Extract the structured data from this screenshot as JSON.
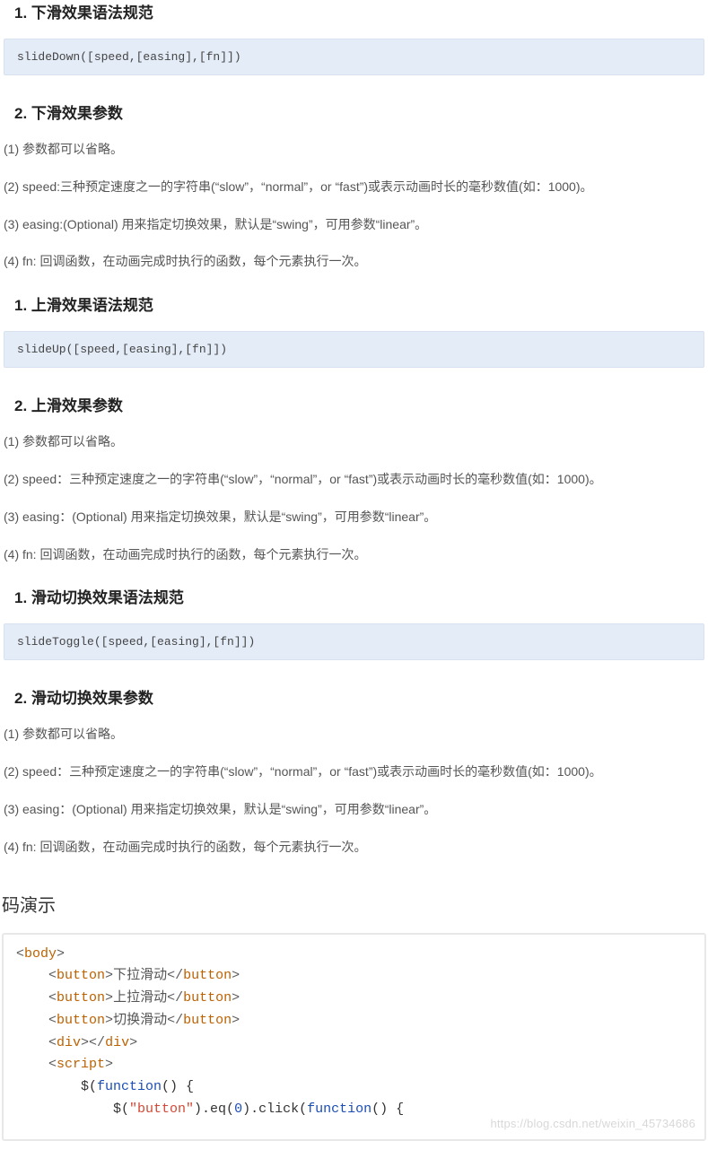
{
  "sections": [
    {
      "heading": "1. 下滑效果语法规范",
      "code": "slideDown([speed,[easing],[fn]])"
    },
    {
      "heading": "2. 下滑效果参数",
      "paras": [
        "(1)  参数都可以省略。",
        "(2)  speed:三种预定速度之一的字符串(“slow”，“normal”，or “fast”)或表示动画时长的毫秒数值(如：1000)。",
        "(3)  easing:(Optional) 用来指定切换效果，默认是“swing”，可用参数“linear”。",
        "(4)  fn:  回调函数，在动画完成时执行的函数，每个元素执行一次。"
      ]
    },
    {
      "heading": "1. 上滑效果语法规范",
      "code": "slideUp([speed,[easing],[fn]])"
    },
    {
      "heading": "2. 上滑效果参数",
      "paras": [
        "(1)  参数都可以省略。",
        "(2)  speed：三种预定速度之一的字符串(“slow”，“normal”，or “fast”)或表示动画时长的毫秒数值(如：1000)。",
        "(3)  easing：(Optional) 用来指定切换效果，默认是“swing”，可用参数“linear”。",
        "(4)  fn:  回调函数，在动画完成时执行的函数，每个元素执行一次。"
      ]
    },
    {
      "heading": "1. 滑动切换效果语法规范",
      "code": "slideToggle([speed,[easing],[fn]])"
    },
    {
      "heading": "2. 滑动切换效果参数",
      "paras": [
        "(1)  参数都可以省略。",
        "(2)  speed：三种预定速度之一的字符串(“slow”，“normal”，or “fast”)或表示动画时长的毫秒数值(如：1000)。",
        "(3)  easing：(Optional) 用来指定切换效果，默认是“swing”，可用参数“linear”。",
        "(4)  fn:  回调函数，在动画完成时执行的函数，每个元素执行一次。"
      ]
    }
  ],
  "demo_title": "码演示",
  "code_lines": [
    [
      {
        "c": "t-pun",
        "t": "<"
      },
      {
        "c": "t-tag",
        "t": "body"
      },
      {
        "c": "t-pun",
        "t": ">"
      }
    ],
    [
      {
        "c": "",
        "t": "    "
      },
      {
        "c": "t-pun",
        "t": "<"
      },
      {
        "c": "t-tag",
        "t": "button"
      },
      {
        "c": "t-pun",
        "t": ">"
      },
      {
        "c": "t-text",
        "t": "下拉滑动"
      },
      {
        "c": "t-pun",
        "t": "</"
      },
      {
        "c": "t-tag",
        "t": "button"
      },
      {
        "c": "t-pun",
        "t": ">"
      }
    ],
    [
      {
        "c": "",
        "t": "    "
      },
      {
        "c": "t-pun",
        "t": "<"
      },
      {
        "c": "t-tag",
        "t": "button"
      },
      {
        "c": "t-pun",
        "t": ">"
      },
      {
        "c": "t-text",
        "t": "上拉滑动"
      },
      {
        "c": "t-pun",
        "t": "</"
      },
      {
        "c": "t-tag",
        "t": "button"
      },
      {
        "c": "t-pun",
        "t": ">"
      }
    ],
    [
      {
        "c": "",
        "t": "    "
      },
      {
        "c": "t-pun",
        "t": "<"
      },
      {
        "c": "t-tag",
        "t": "button"
      },
      {
        "c": "t-pun",
        "t": ">"
      },
      {
        "c": "t-text",
        "t": "切换滑动"
      },
      {
        "c": "t-pun",
        "t": "</"
      },
      {
        "c": "t-tag",
        "t": "button"
      },
      {
        "c": "t-pun",
        "t": ">"
      }
    ],
    [
      {
        "c": "",
        "t": "    "
      },
      {
        "c": "t-pun",
        "t": "<"
      },
      {
        "c": "t-tag",
        "t": "div"
      },
      {
        "c": "t-pun",
        "t": "></"
      },
      {
        "c": "t-tag",
        "t": "div"
      },
      {
        "c": "t-pun",
        "t": ">"
      }
    ],
    [
      {
        "c": "",
        "t": "    "
      },
      {
        "c": "t-pun",
        "t": "<"
      },
      {
        "c": "t-tag",
        "t": "script"
      },
      {
        "c": "t-pun",
        "t": ">"
      }
    ],
    [
      {
        "c": "",
        "t": "        $("
      },
      {
        "c": "t-key",
        "t": "function"
      },
      {
        "c": "",
        "t": "() {"
      }
    ],
    [
      {
        "c": "",
        "t": "            $("
      },
      {
        "c": "t-str",
        "t": "\"button\""
      },
      {
        "c": "",
        "t": ").eq("
      },
      {
        "c": "t-num",
        "t": "0"
      },
      {
        "c": "",
        "t": ").click("
      },
      {
        "c": "t-key",
        "t": "function"
      },
      {
        "c": "",
        "t": "() {"
      }
    ]
  ],
  "watermark": "https://blog.csdn.net/weixin_45734686"
}
